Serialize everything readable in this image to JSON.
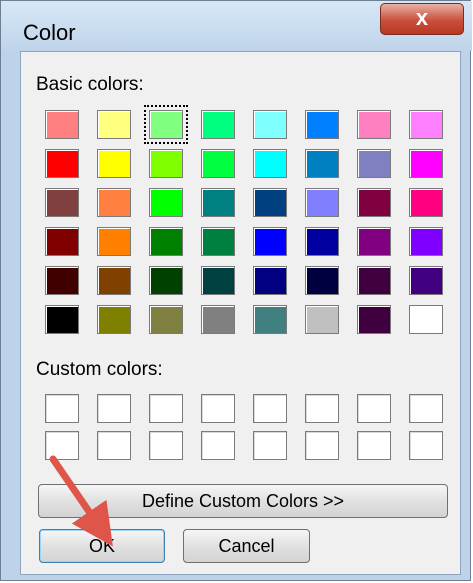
{
  "window": {
    "title": "Color",
    "close_glyph": "x"
  },
  "basic_colors": {
    "label": "Basic colors:",
    "selected_index": 2,
    "swatches": [
      "#ff8080",
      "#ffff80",
      "#80ff80",
      "#00ff80",
      "#80ffff",
      "#0080ff",
      "#ff80c0",
      "#ff80ff",
      "#ff0000",
      "#ffff00",
      "#80ff00",
      "#00ff40",
      "#00ffff",
      "#0080c0",
      "#8080c0",
      "#ff00ff",
      "#804040",
      "#ff8040",
      "#00ff00",
      "#008080",
      "#004080",
      "#8080ff",
      "#800040",
      "#ff0080",
      "#800000",
      "#ff8000",
      "#008000",
      "#008040",
      "#0000ff",
      "#0000a0",
      "#800080",
      "#8000ff",
      "#400000",
      "#804000",
      "#004000",
      "#004040",
      "#000080",
      "#000040",
      "#400040",
      "#400080",
      "#000000",
      "#808000",
      "#808040",
      "#808080",
      "#408080",
      "#c0c0c0",
      "#400040",
      "#ffffff"
    ]
  },
  "custom_colors": {
    "label": "Custom colors:",
    "swatches": [
      "#ffffff",
      "#ffffff",
      "#ffffff",
      "#ffffff",
      "#ffffff",
      "#ffffff",
      "#ffffff",
      "#ffffff",
      "#ffffff",
      "#ffffff",
      "#ffffff",
      "#ffffff",
      "#ffffff",
      "#ffffff",
      "#ffffff",
      "#ffffff"
    ]
  },
  "buttons": {
    "define_custom": "Define Custom Colors >>",
    "ok": "OK",
    "cancel": "Cancel"
  },
  "colors": {
    "annotation_arrow": "#e0554a"
  }
}
